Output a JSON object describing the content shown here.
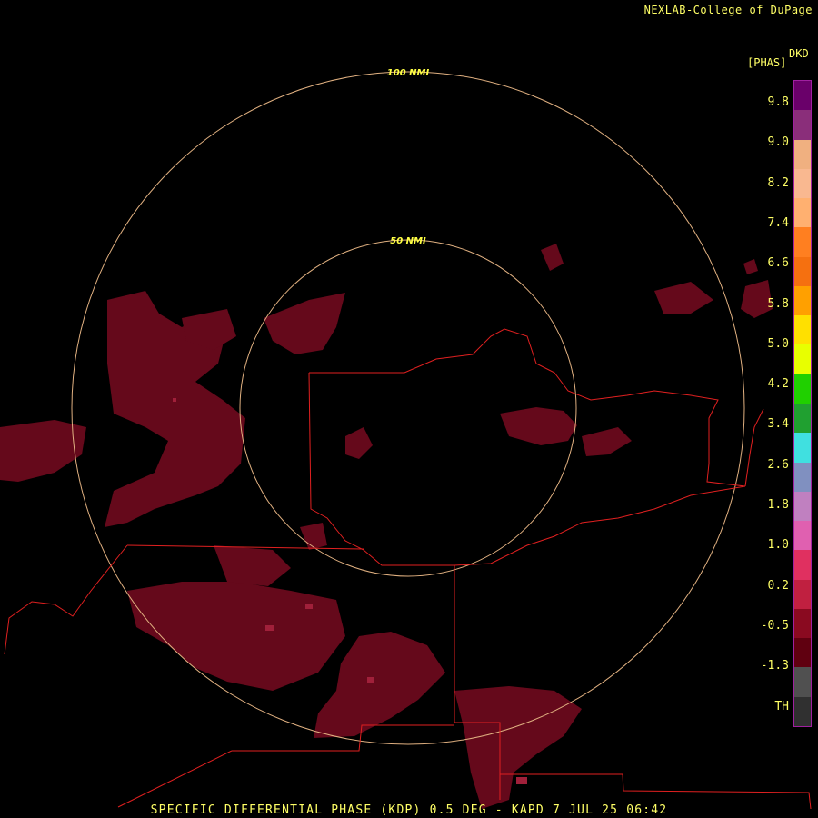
{
  "credit": "NEXLAB-College of DuPage",
  "product_code": "DKD",
  "units": "[PHAS]",
  "ring_labels": {
    "inner": "50 NMI",
    "outer": "100 NMI"
  },
  "legend": {
    "ticks": [
      "9.8",
      "9.0",
      "8.2",
      "7.4",
      "6.6",
      "5.8",
      "5.0",
      "4.2",
      "3.4",
      "2.6",
      "1.8",
      "1.0",
      "0.2",
      "-0.5",
      "-1.3",
      "TH"
    ],
    "colors": [
      "#6a006a",
      "#8a2e7a",
      "#f0b080",
      "#f9b890",
      "#ffb070",
      "#ff7f20",
      "#f57010",
      "#ffa000",
      "#ffe000",
      "#e8ff00",
      "#20d000",
      "#20a030",
      "#40e0e0",
      "#8090c0",
      "#c080c0",
      "#e060b0",
      "#e03060",
      "#c02040",
      "#8a0a20",
      "#600010",
      "#505050",
      "#303030"
    ],
    "value_range": [
      -1.3,
      9.8
    ]
  },
  "footer": "SPECIFIC DIFFERENTIAL PHASE (KDP) 0.5 DEG - KAPD 7 JUL 25 06:42",
  "colors": {
    "ring": "#e0b080",
    "boundary": "#e02020",
    "echo": "#7a0a20",
    "echo_hi": "#b02040"
  }
}
